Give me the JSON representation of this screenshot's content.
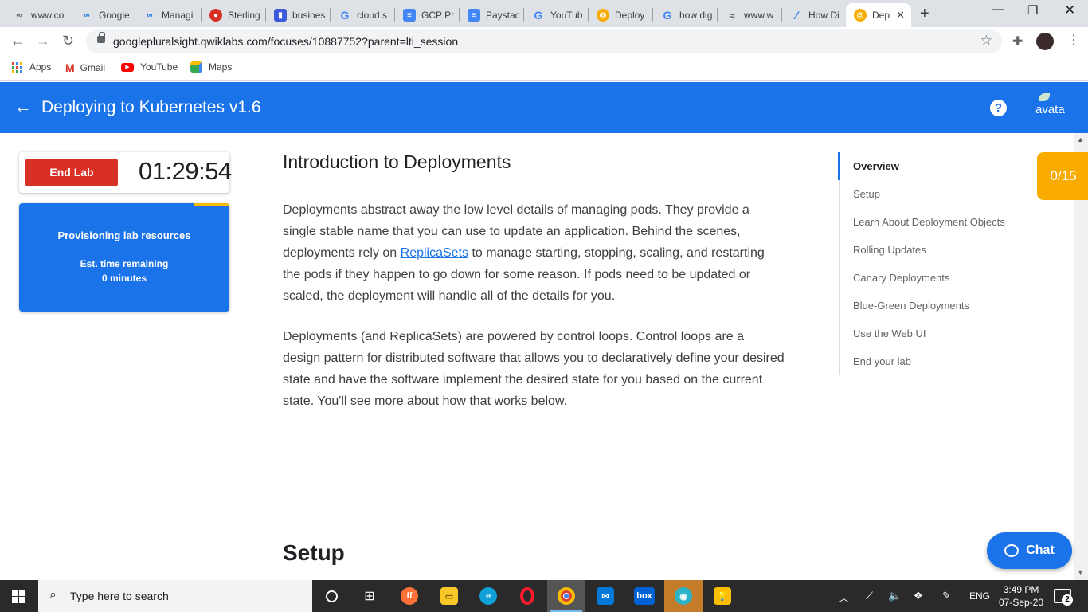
{
  "browser": {
    "tabs": [
      {
        "title": "www.co",
        "icon": "infinity-icon",
        "color": "#5f6368"
      },
      {
        "title": "Google",
        "icon": "infinity-icon",
        "color": "#1a73e8"
      },
      {
        "title": "Managi",
        "icon": "infinity-icon",
        "color": "#1a73e8"
      },
      {
        "title": "Sterling",
        "icon": "record-icon",
        "color": "#d93025"
      },
      {
        "title": "busines",
        "icon": "bookmark-icon",
        "color": "#3b5bdb"
      },
      {
        "title": "cloud s",
        "icon": "google-icon",
        "color": "#4285f4"
      },
      {
        "title": "GCP Pr",
        "icon": "doc-icon",
        "color": "#4285f4"
      },
      {
        "title": "Paystac",
        "icon": "doc-lines-icon",
        "color": "#4285f4"
      },
      {
        "title": "YouTub",
        "icon": "google-icon",
        "color": "#4285f4"
      },
      {
        "title": "Deploy",
        "icon": "qwiklabs-icon",
        "color": "#f9ab00"
      },
      {
        "title": "how dig",
        "icon": "google-icon",
        "color": "#4285f4"
      },
      {
        "title": "www.w",
        "icon": "wave-icon",
        "color": "#5f6368"
      },
      {
        "title": "How Di",
        "icon": "feather-icon",
        "color": "#1a73e8"
      },
      {
        "title": "Dep",
        "icon": "qwiklabs-icon",
        "color": "#f9ab00"
      }
    ],
    "url": "googlepluralsight.qwiklabs.com/focuses/10887752?parent=lti_session",
    "bookmarks": [
      "Apps",
      "Gmail",
      "YouTube",
      "Maps"
    ]
  },
  "header": {
    "title": "Deploying to Kubernetes v1.6",
    "avatar_text": "avata"
  },
  "lab": {
    "end_label": "End Lab",
    "timer": "01:29:54",
    "provisioning_title": "Provisioning lab resources",
    "est_label": "Est. time remaining",
    "est_value": "0 minutes",
    "score": "0/15"
  },
  "content": {
    "heading": "Introduction to Deployments",
    "p1_a": "Deployments abstract away the low level details of managing pods. They provide a single stable name that you can use to update an application. Behind the scenes, deployments rely on ",
    "p1_link": "ReplicaSets",
    "p1_b": " to manage starting, stopping, scaling, and restarting the pods if they happen to go down for some reason. If pods need to be updated or scaled, the deployment will handle all of the details for you.",
    "p2": "Deployments (and ReplicaSets) are powered by control loops. Control loops are a design pattern for distributed software that allows you to declaratively define your desired state and have the software implement the desired state for you based on the current state. You'll see more about how that works below.",
    "setup_heading": "Setup"
  },
  "toc": [
    "Overview",
    "Setup",
    "Learn About Deployment Objects",
    "Rolling Updates",
    "Canary Deployments",
    "Blue-Green Deployments",
    "Use the Web UI",
    "End your lab"
  ],
  "chat_label": "Chat",
  "taskbar": {
    "search_placeholder": "Type here to search",
    "lang": "ENG",
    "time": "3:49 PM",
    "date": "07-Sep-20",
    "notifications": "2"
  }
}
